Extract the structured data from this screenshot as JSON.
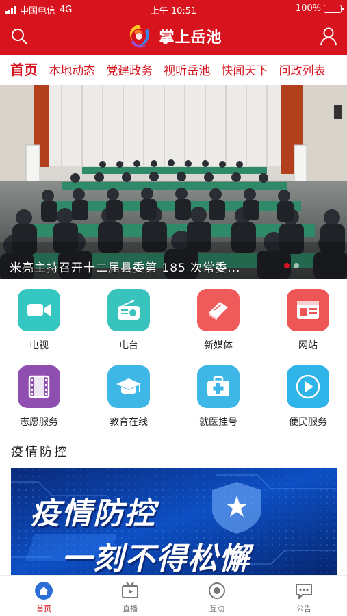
{
  "status_bar": {
    "carrier": "中国电信",
    "network": "4G",
    "time": "上午 10:51",
    "battery": "100%"
  },
  "header": {
    "app_title": "掌上岳池",
    "logo_icon": "yuechi-swirl-logo",
    "search_icon": "search-icon",
    "user_icon": "user-icon"
  },
  "nav_tabs": [
    {
      "label": "首页",
      "active": true
    },
    {
      "label": "本地动态"
    },
    {
      "label": "党建政务"
    },
    {
      "label": "视听岳池"
    },
    {
      "label": "快闻天下"
    },
    {
      "label": "问政列表"
    }
  ],
  "banner": {
    "caption": "米亮主持召开十二届县委第 185 次常委..."
  },
  "services": [
    {
      "label": "电视",
      "icon": "video-camera-icon",
      "color": "#34c7c1"
    },
    {
      "label": "电台",
      "icon": "radio-icon",
      "color": "#39c3bd"
    },
    {
      "label": "新媒体",
      "icon": "book-icon",
      "color": "#ef5a5a"
    },
    {
      "label": "网站",
      "icon": "browser-icon",
      "color": "#ee5555"
    },
    {
      "label": "志愿服务",
      "icon": "film-icon",
      "color": "#8e4fb0"
    },
    {
      "label": "教育在线",
      "icon": "graduation-cap-icon",
      "color": "#3fb7e6"
    },
    {
      "label": "就医挂号",
      "icon": "medical-kit-icon",
      "color": "#3fb7e6"
    },
    {
      "label": "便民服务",
      "icon": "play-circle-icon",
      "color": "#2fb4ea"
    }
  ],
  "section": {
    "title": "疫情防控"
  },
  "promo": {
    "line1": "疫情防控",
    "line2": "一刻不得松懈"
  },
  "bottom_nav": [
    {
      "label": "首页",
      "icon": "home-icon",
      "active": true
    },
    {
      "label": "直播",
      "icon": "tv-icon"
    },
    {
      "label": "互动",
      "icon": "interact-icon"
    },
    {
      "label": "公告",
      "icon": "message-icon"
    }
  ],
  "colors": {
    "brand_red": "#d7141e",
    "promo_blue": "#0b3ea8"
  }
}
